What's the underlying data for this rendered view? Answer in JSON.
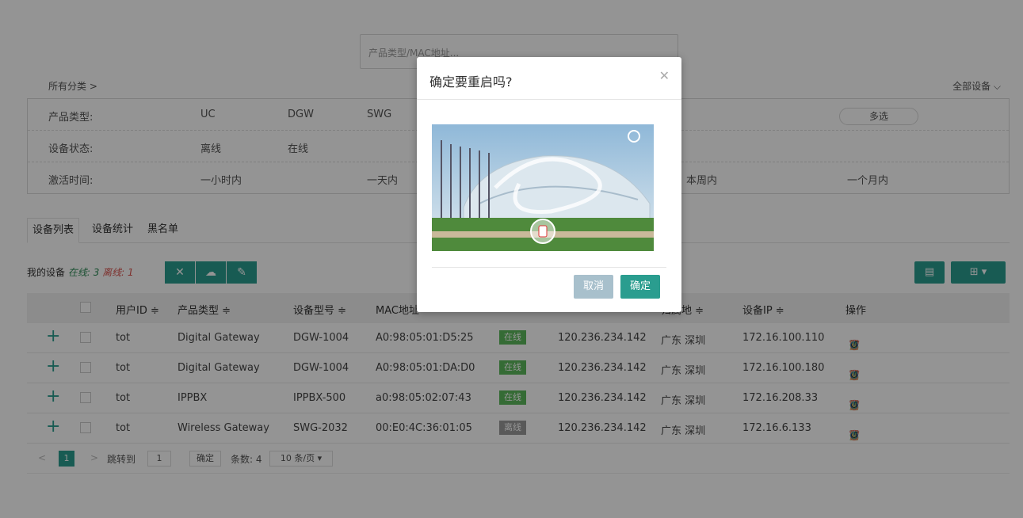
{
  "search": {
    "placeholder": "产品类型/MAC地址..."
  },
  "breadcrumb": "所有分类 >",
  "all_devices": "全部设备",
  "filters": {
    "product_type": {
      "label": "产品类型:",
      "options": [
        "UC",
        "DGW",
        "SWG"
      ],
      "multi": "多选"
    },
    "device_status": {
      "label": "设备状态:",
      "options": [
        "离线",
        "在线"
      ]
    },
    "activation_time": {
      "label": "激活时间:",
      "options": [
        "一小时内",
        "一天内",
        "本周内",
        "一个月内"
      ]
    }
  },
  "tabs": [
    "设备列表",
    "设备统计",
    "黑名单"
  ],
  "summary": {
    "prefix": "我的设备",
    "online": "在线: 3",
    "offline": "离线: 1"
  },
  "table": {
    "headers": [
      "用户ID ≑",
      "产品类型 ≑",
      "设备型号 ≑",
      "MAC地址",
      "归属地 ≑",
      "设备IP ≑",
      "操作"
    ],
    "rows": [
      {
        "user": "tot",
        "type": "Digital Gateway",
        "model": "DGW-1004",
        "mac": "A0:98:05:01:D5:25",
        "status": "在线",
        "public_ip": "120.236.234.142",
        "location": "广东 深圳",
        "ip": "172.16.100.110"
      },
      {
        "user": "tot",
        "type": "Digital Gateway",
        "model": "DGW-1004",
        "mac": "A0:98:05:01:DA:D0",
        "status": "在线",
        "public_ip": "120.236.234.142",
        "location": "广东 深圳",
        "ip": "172.16.100.180"
      },
      {
        "user": "tot",
        "type": "IPPBX",
        "model": "IPPBX-500",
        "mac": "a0:98:05:02:07:43",
        "status": "在线",
        "public_ip": "120.236.234.142",
        "location": "广东 深圳",
        "ip": "172.16.208.33"
      },
      {
        "user": "tot",
        "type": "Wireless Gateway",
        "model": "SWG-2032",
        "mac": "00:E0:4C:36:01:05",
        "status": "离线",
        "public_ip": "120.236.234.142",
        "location": "广东 深圳",
        "ip": "172.16.6.133"
      }
    ]
  },
  "pager": {
    "page": "1",
    "goto": "跳转到",
    "goto_value": "1",
    "confirm": "确定",
    "count": "条数: 4",
    "per_page": "10 条/页 ▾"
  },
  "modal": {
    "title": "确定要重启吗?",
    "cancel": "取消",
    "ok": "确定"
  },
  "colors": {
    "accent": "#2a9d8f",
    "online": "#5cb85c",
    "offline": "#999999",
    "danger": "#d9534f"
  }
}
